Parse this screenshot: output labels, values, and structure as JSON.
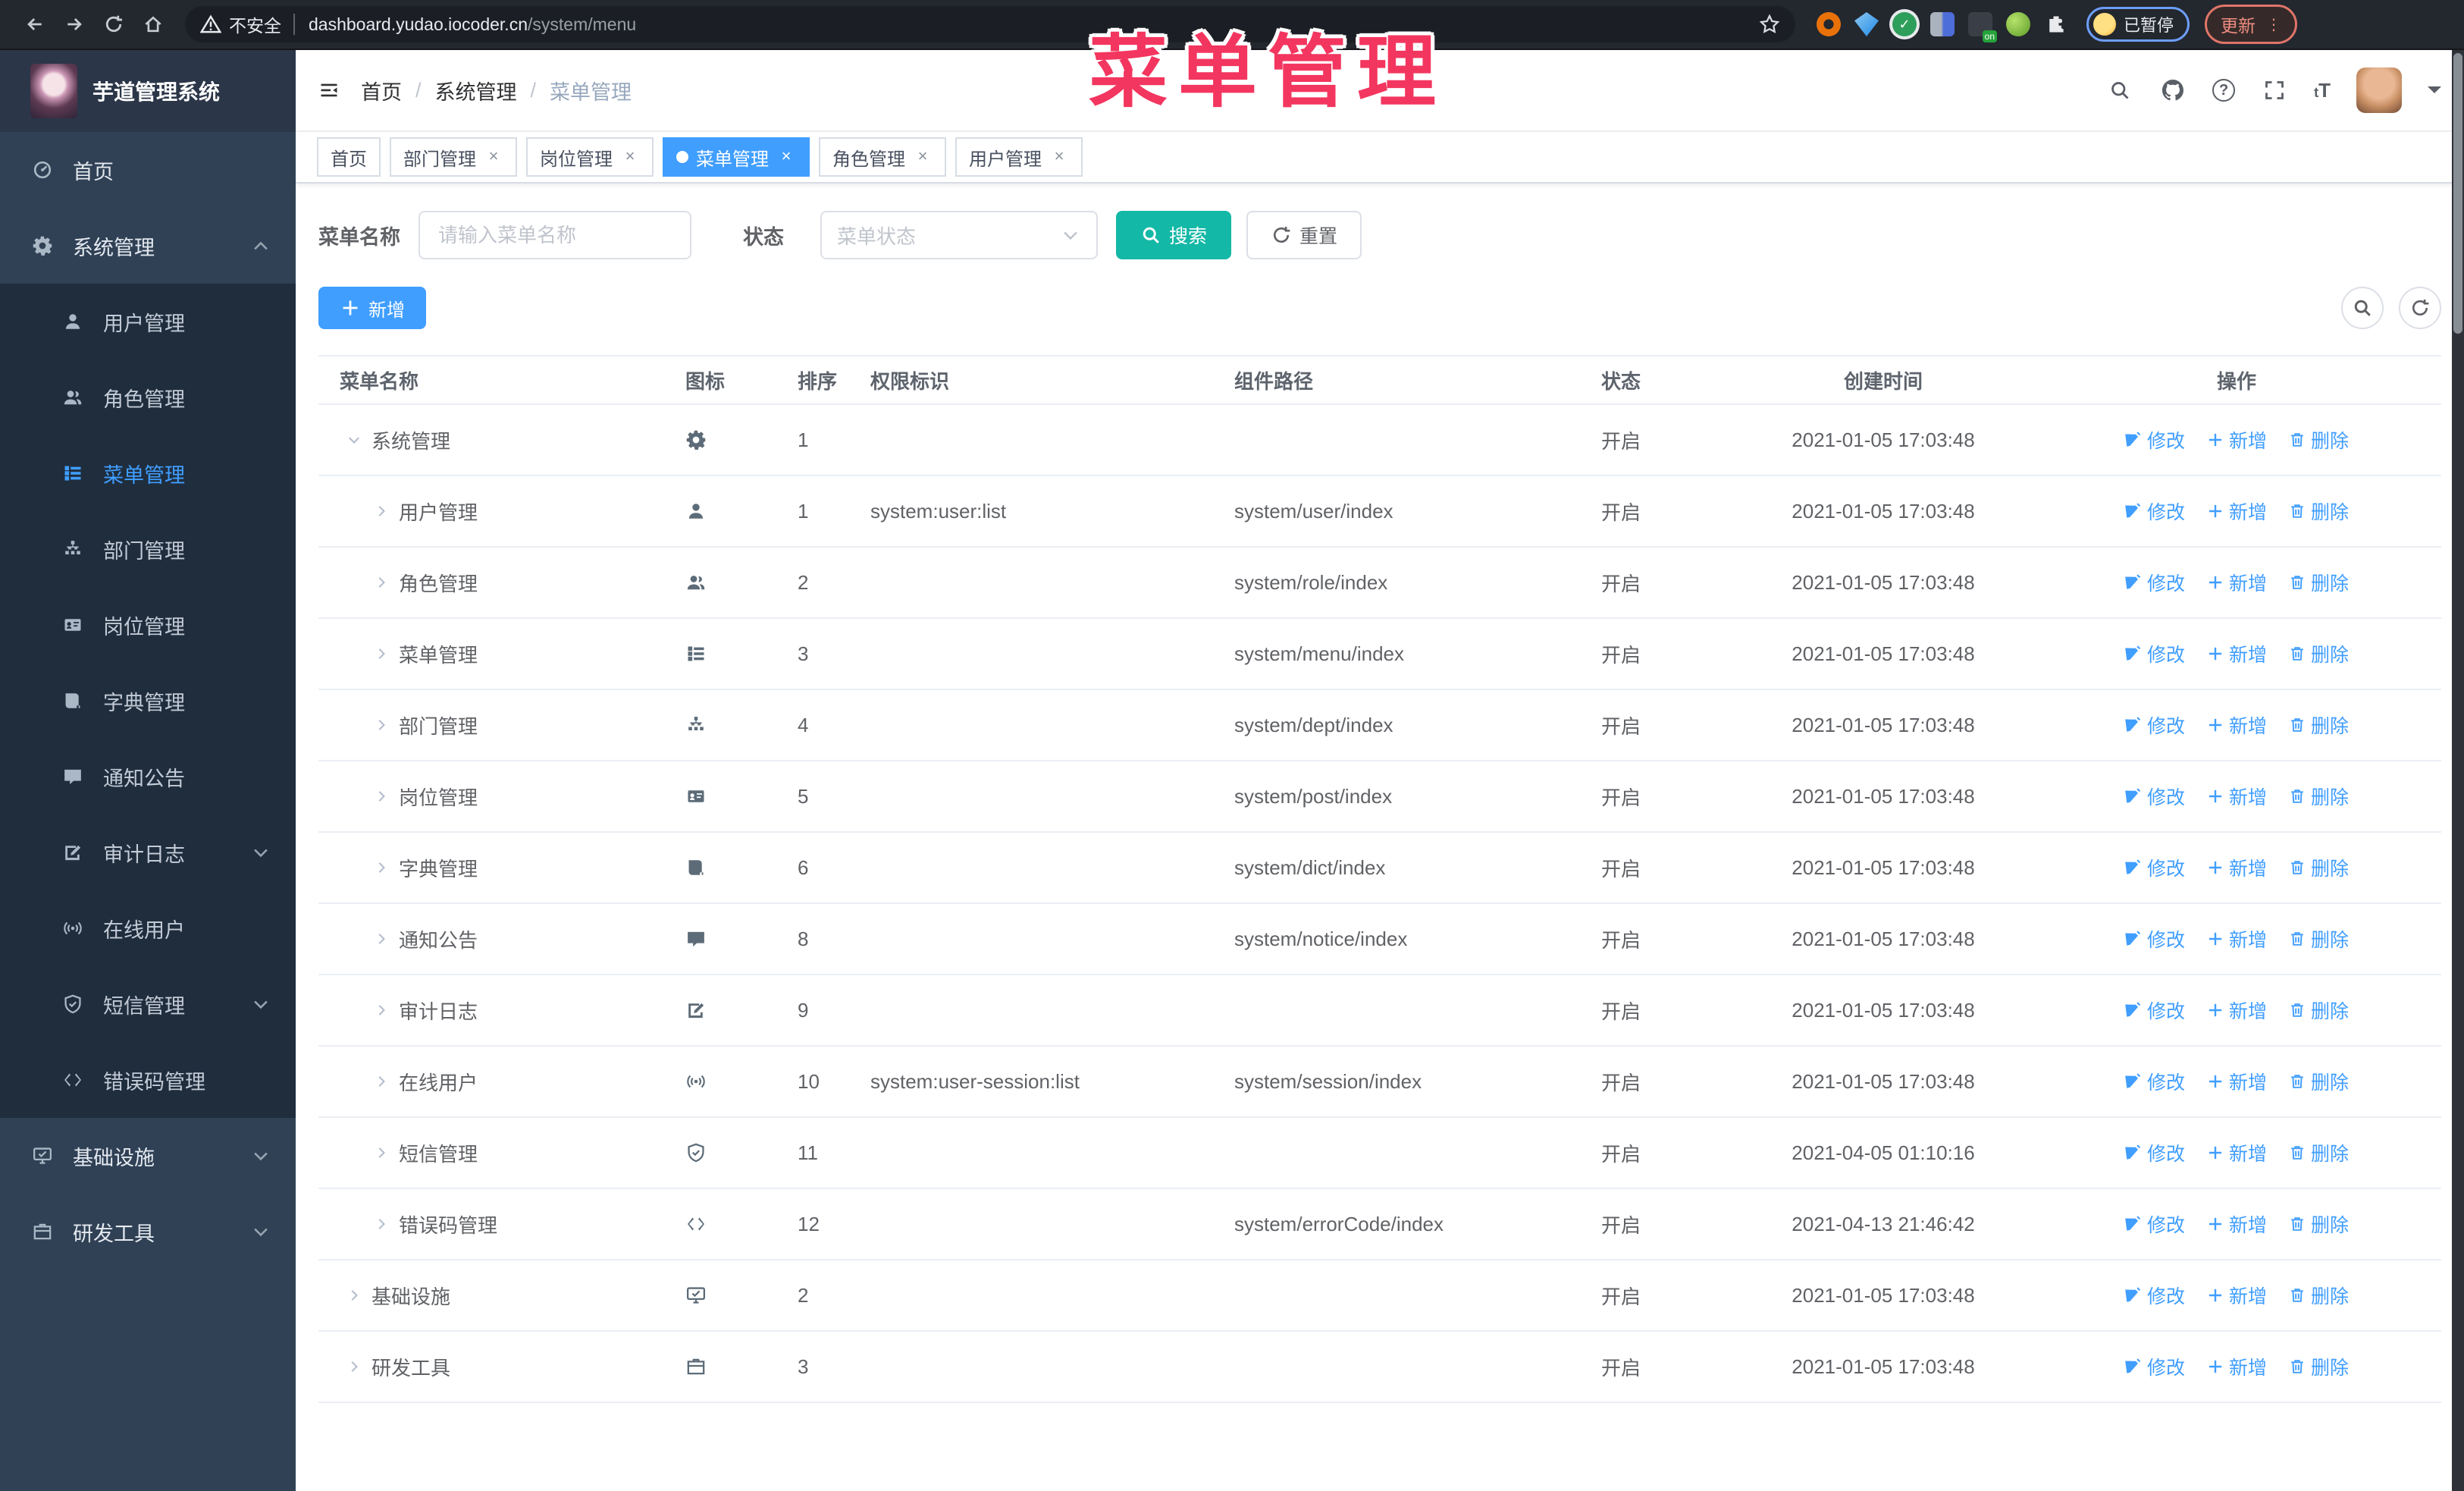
{
  "browser": {
    "security_label": "不安全",
    "url_host": "dashboard.yudao.iocoder.cn",
    "url_path": "/system/menu",
    "paused_label": "已暂停",
    "update_label": "更新",
    "extensions": [
      "orange-circle-icon",
      "gem-icon",
      "green-check-icon",
      "split-tiles-icon",
      "dark-on-badge-icon",
      "frog-icon",
      "puzzle-icon"
    ]
  },
  "annotation": {
    "text": "菜单管理",
    "color": "#f3365f"
  },
  "sidebar": {
    "title": "芋道管理系统",
    "menu": [
      {
        "icon": "dashboard-icon",
        "label": "首页"
      },
      {
        "icon": "gear-icon",
        "label": "系统管理",
        "state": "expanded",
        "children": [
          {
            "icon": "user-icon",
            "label": "用户管理"
          },
          {
            "icon": "users-icon",
            "label": "角色管理"
          },
          {
            "icon": "menu-icon",
            "label": "菜单管理",
            "active": true
          },
          {
            "icon": "tree-icon",
            "label": "部门管理"
          },
          {
            "icon": "badge-icon",
            "label": "岗位管理"
          },
          {
            "icon": "book-icon",
            "label": "字典管理"
          },
          {
            "icon": "message-icon",
            "label": "通知公告"
          },
          {
            "icon": "log-icon",
            "label": "审计日志",
            "state": "collapsed"
          },
          {
            "icon": "online-icon",
            "label": "在线用户"
          },
          {
            "icon": "shield-icon",
            "label": "短信管理",
            "state": "collapsed"
          },
          {
            "icon": "code-icon",
            "label": "错误码管理"
          }
        ]
      },
      {
        "icon": "monitor-icon",
        "label": "基础设施",
        "state": "collapsed"
      },
      {
        "icon": "briefcase-icon",
        "label": "研发工具",
        "state": "collapsed"
      }
    ]
  },
  "navbar": {
    "breadcrumb": [
      "首页",
      "系统管理",
      "菜单管理"
    ]
  },
  "tags": [
    {
      "label": "首页",
      "closable": false,
      "active": false
    },
    {
      "label": "部门管理",
      "closable": true,
      "active": false
    },
    {
      "label": "岗位管理",
      "closable": true,
      "active": false
    },
    {
      "label": "菜单管理",
      "closable": true,
      "active": true
    },
    {
      "label": "角色管理",
      "closable": true,
      "active": false
    },
    {
      "label": "用户管理",
      "closable": true,
      "active": false
    }
  ],
  "filters": {
    "name_label": "菜单名称",
    "name_placeholder": "请输入菜单名称",
    "status_label": "状态",
    "status_placeholder": "菜单状态",
    "search_label": "搜索",
    "reset_label": "重置"
  },
  "toolbar": {
    "add_label": "新增"
  },
  "table": {
    "columns": [
      "菜单名称",
      "图标",
      "排序",
      "权限标识",
      "组件路径",
      "状态",
      "创建时间",
      "操作"
    ],
    "op_labels": [
      "修改",
      "新增",
      "删除"
    ],
    "rows": [
      {
        "name": "系统管理",
        "level": 0,
        "chevron": "down",
        "icon": "gear-icon",
        "sort": "1",
        "perm": "",
        "path": "",
        "status": "开启",
        "time": "2021-01-05 17:03:48"
      },
      {
        "name": "用户管理",
        "level": 1,
        "chevron": "right",
        "icon": "user-icon",
        "sort": "1",
        "perm": "system:user:list",
        "path": "system/user/index",
        "status": "开启",
        "time": "2021-01-05 17:03:48"
      },
      {
        "name": "角色管理",
        "level": 1,
        "chevron": "right",
        "icon": "users-icon",
        "sort": "2",
        "perm": "",
        "path": "system/role/index",
        "status": "开启",
        "time": "2021-01-05 17:03:48"
      },
      {
        "name": "菜单管理",
        "level": 1,
        "chevron": "right",
        "icon": "menu-icon",
        "sort": "3",
        "perm": "",
        "path": "system/menu/index",
        "status": "开启",
        "time": "2021-01-05 17:03:48"
      },
      {
        "name": "部门管理",
        "level": 1,
        "chevron": "right",
        "icon": "tree-icon",
        "sort": "4",
        "perm": "",
        "path": "system/dept/index",
        "status": "开启",
        "time": "2021-01-05 17:03:48"
      },
      {
        "name": "岗位管理",
        "level": 1,
        "chevron": "right",
        "icon": "badge-icon",
        "sort": "5",
        "perm": "",
        "path": "system/post/index",
        "status": "开启",
        "time": "2021-01-05 17:03:48"
      },
      {
        "name": "字典管理",
        "level": 1,
        "chevron": "right",
        "icon": "book-icon",
        "sort": "6",
        "perm": "",
        "path": "system/dict/index",
        "status": "开启",
        "time": "2021-01-05 17:03:48"
      },
      {
        "name": "通知公告",
        "level": 1,
        "chevron": "right",
        "icon": "message-icon",
        "sort": "8",
        "perm": "",
        "path": "system/notice/index",
        "status": "开启",
        "time": "2021-01-05 17:03:48"
      },
      {
        "name": "审计日志",
        "level": 1,
        "chevron": "right",
        "icon": "log-icon",
        "sort": "9",
        "perm": "",
        "path": "",
        "status": "开启",
        "time": "2021-01-05 17:03:48"
      },
      {
        "name": "在线用户",
        "level": 1,
        "chevron": "right",
        "icon": "online-icon",
        "sort": "10",
        "perm": "system:user-session:list",
        "path": "system/session/index",
        "status": "开启",
        "time": "2021-01-05 17:03:48"
      },
      {
        "name": "短信管理",
        "level": 1,
        "chevron": "right",
        "icon": "shield-icon",
        "sort": "11",
        "perm": "",
        "path": "",
        "status": "开启",
        "time": "2021-04-05 01:10:16"
      },
      {
        "name": "错误码管理",
        "level": 1,
        "chevron": "right",
        "icon": "code-icon",
        "sort": "12",
        "perm": "",
        "path": "system/errorCode/index",
        "status": "开启",
        "time": "2021-04-13 21:46:42"
      },
      {
        "name": "基础设施",
        "level": 0,
        "chevron": "right",
        "icon": "monitor-icon",
        "sort": "2",
        "perm": "",
        "path": "",
        "status": "开启",
        "time": "2021-01-05 17:03:48"
      },
      {
        "name": "研发工具",
        "level": 0,
        "chevron": "right",
        "icon": "briefcase-icon",
        "sort": "3",
        "perm": "",
        "path": "",
        "status": "开启",
        "time": "2021-01-05 17:03:48"
      }
    ]
  }
}
